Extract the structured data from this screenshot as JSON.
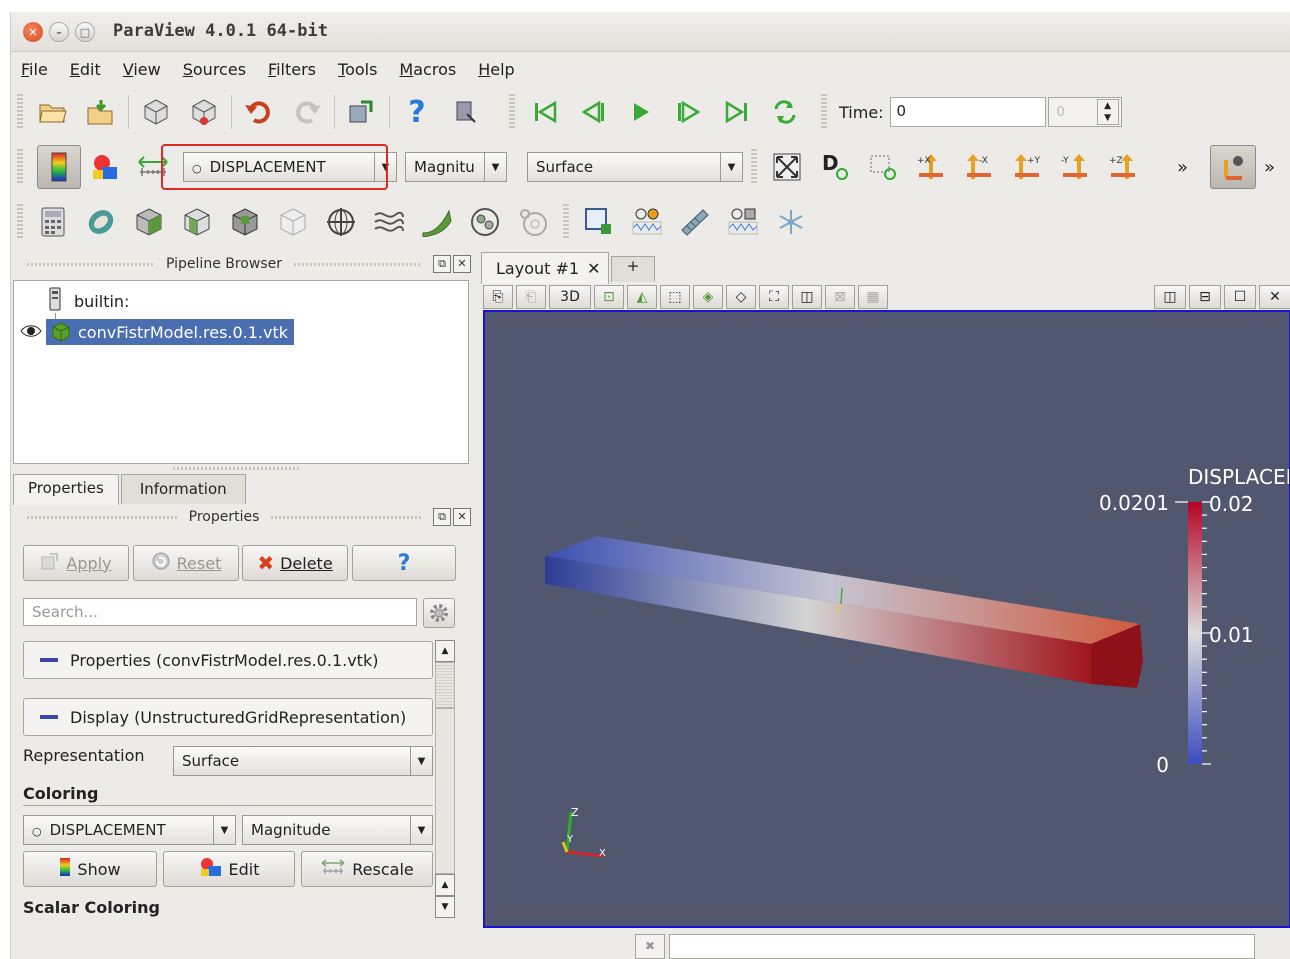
{
  "window": {
    "title": "ParaView 4.0.1 64-bit"
  },
  "menu": [
    "File",
    "Edit",
    "View",
    "Sources",
    "Filters",
    "Tools",
    "Macros",
    "Help"
  ],
  "menu_mnemonic": [
    "F",
    "E",
    "V",
    "S",
    "F",
    "T",
    "M",
    "H"
  ],
  "time": {
    "label": "Time:",
    "value": "0",
    "spin_value": "0"
  },
  "toolbar2": {
    "color_array": "DISPLACEMENT",
    "component": "Magnitu",
    "representation": "Surface",
    "more": "»"
  },
  "pipeline": {
    "title": "Pipeline Browser",
    "root": "builtin:",
    "source": "convFistrModel.res.0.1.vtk"
  },
  "tabs": {
    "properties": "Properties",
    "information": "Information"
  },
  "properties_panel": {
    "title": "Properties",
    "apply": "Apply",
    "reset": "Reset",
    "delete": "Delete",
    "help": "?",
    "search_placeholder": "Search...",
    "section_properties": "Properties (convFistrModel.res.0.1.vtk)",
    "section_display": "Display (UnstructuredGridRepresentation)",
    "representation_label": "Representation",
    "representation_value": "Surface",
    "coloring_label": "Coloring",
    "coloring_array": "DISPLACEMENT",
    "coloring_component": "Magnitude",
    "show": "Show",
    "edit": "Edit",
    "rescale": "Rescale",
    "scalar_coloring": "Scalar Coloring"
  },
  "layout": {
    "tab": "Layout #1",
    "plus": "+",
    "mode_3d": "3D"
  },
  "colorbar": {
    "title": "DISPLACEM",
    "range_max": "0.0201",
    "tick_top": "0.02",
    "tick_mid": "0.01",
    "tick_bottom": "0",
    "colors": [
      "#3a4cc0",
      "#dddcdc",
      "#b40426"
    ]
  },
  "axes": {
    "z": "Z",
    "y": "Y",
    "x": "X"
  }
}
